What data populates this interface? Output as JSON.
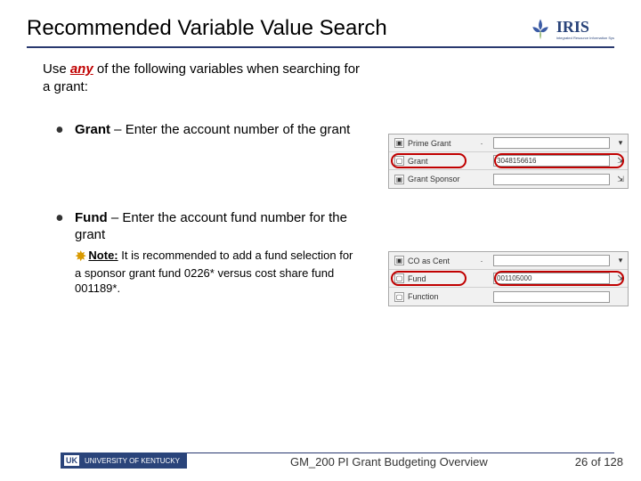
{
  "header": {
    "title": "Recommended Variable Value Search",
    "logo_text": "IRIS",
    "logo_sub": "Integrated Resource Information Sys"
  },
  "intro": {
    "prefix": "Use ",
    "emphasis": "any",
    "suffix": " of the following variables when searching for a grant:"
  },
  "bullets": [
    {
      "term": "Grant",
      "desc": " – Enter the account number of the grant",
      "snippet": {
        "rows": [
          {
            "icon": "▣",
            "label": "Prime Grant",
            "mid": "·",
            "value": "",
            "end": "▾"
          },
          {
            "icon": "▢",
            "label": "Grant",
            "mid": "",
            "value": "3048156616",
            "end": "⇲",
            "circled": true
          },
          {
            "icon": "▣",
            "label": "Grant Sponsor",
            "mid": "",
            "value": "",
            "end": "⇲"
          }
        ]
      }
    },
    {
      "term": "Fund",
      "desc": " – Enter the account fund number for the grant",
      "note": {
        "label": "Note:",
        "text": " It is recommended to add a fund selection for a sponsor grant fund 0226* versus cost share fund 001189*."
      },
      "snippet": {
        "rows": [
          {
            "icon": "▣",
            "label": "CO as Cent",
            "mid": "·",
            "value": "",
            "end": "▾"
          },
          {
            "icon": "▢",
            "label": "Fund",
            "mid": "",
            "value": "001105000",
            "end": "⇲",
            "circled": true
          },
          {
            "icon": "▢",
            "label": "Function",
            "mid": "",
            "value": "",
            "end": ""
          }
        ]
      }
    }
  ],
  "footer": {
    "uk": "UK",
    "uni": "UNIVERSITY OF KENTUCKY",
    "doc": "GM_200 PI Grant Budgeting Overview",
    "page": "26 of 128"
  }
}
